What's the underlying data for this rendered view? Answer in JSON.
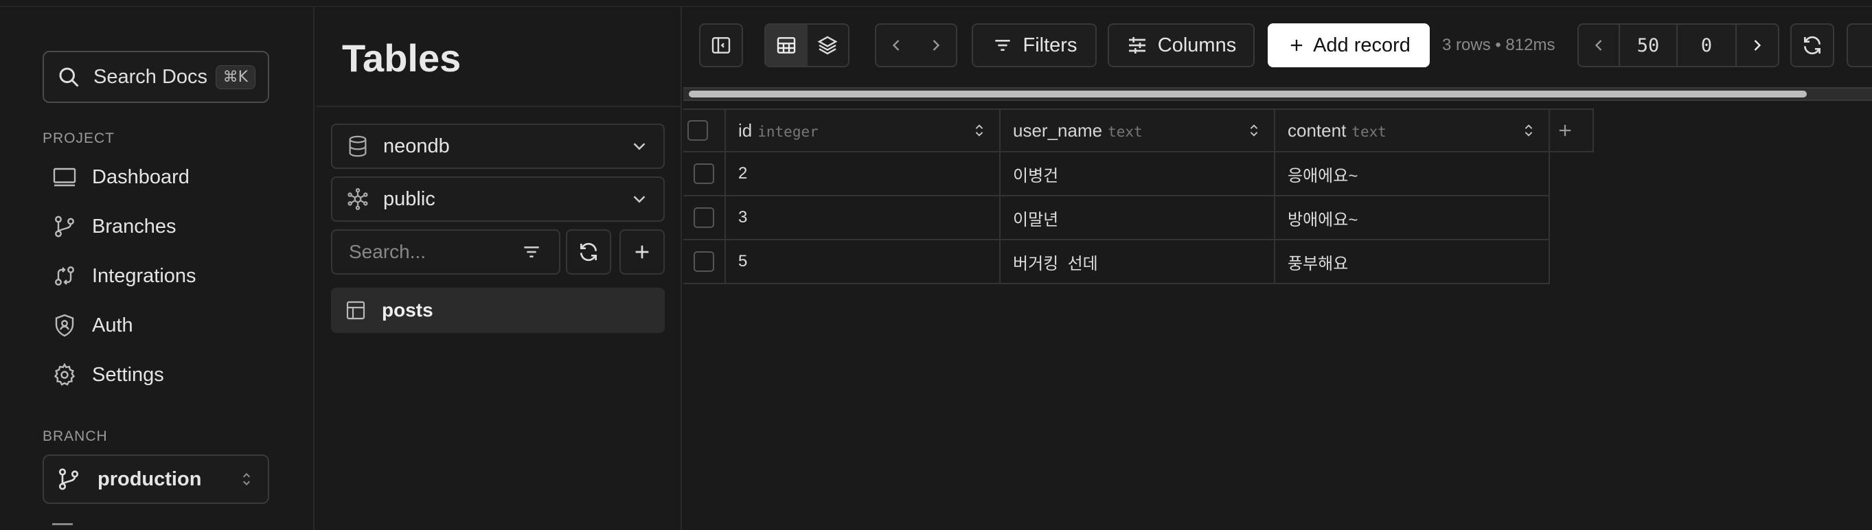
{
  "sidebar": {
    "search": {
      "label": "Search Docs",
      "shortcut": "⌘K"
    },
    "project_label": "PROJECT",
    "nav": [
      {
        "label": "Dashboard",
        "icon": "monitor-icon"
      },
      {
        "label": "Branches",
        "icon": "git-branch-icon"
      },
      {
        "label": "Integrations",
        "icon": "integrations-icon"
      },
      {
        "label": "Auth",
        "icon": "shield-user-icon"
      },
      {
        "label": "Settings",
        "icon": "gear-icon"
      }
    ],
    "branch_label": "BRANCH",
    "branch": {
      "value": "production",
      "icon": "git-branch-icon"
    }
  },
  "tables_panel": {
    "title": "Tables",
    "database": {
      "value": "neondb",
      "icon": "database-icon"
    },
    "schema": {
      "value": "public",
      "icon": "schema-icon"
    },
    "search_placeholder": "Search...",
    "tables": [
      {
        "name": "posts",
        "icon": "table-icon"
      }
    ]
  },
  "toolbar": {
    "filters_label": "Filters",
    "columns_label": "Columns",
    "add_record_label": "Add record",
    "row_info": "3 rows • 812ms",
    "limit": "50",
    "offset": "0"
  },
  "grid": {
    "columns": [
      {
        "name": "id",
        "type": "integer"
      },
      {
        "name": "user_name",
        "type": "text"
      },
      {
        "name": "content",
        "type": "text"
      }
    ],
    "rows": [
      [
        "2",
        "이병건",
        "응애에요~"
      ],
      [
        "3",
        "이말년",
        "방애에요~"
      ],
      [
        "5",
        "버거킹  선데",
        "풍부해요"
      ]
    ]
  },
  "colors": {
    "background": "#1a1a1a",
    "primary_button": "#ffffff",
    "border": "#383838"
  }
}
